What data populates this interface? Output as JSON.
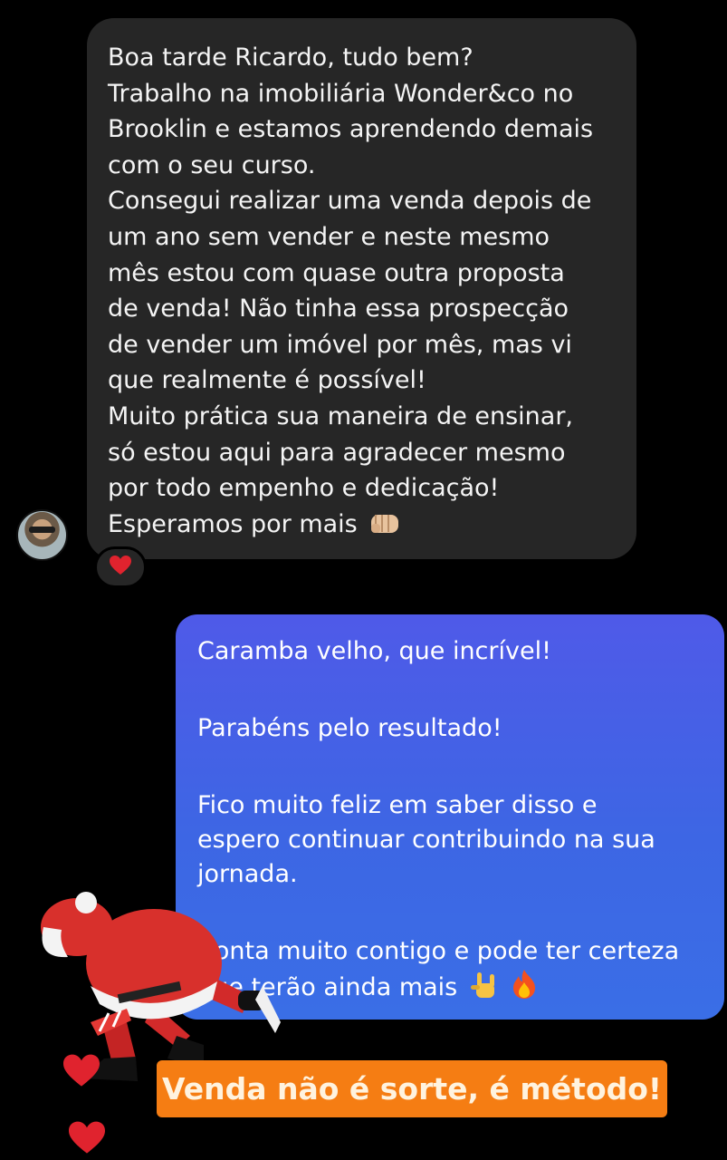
{
  "incoming_message": {
    "lines": [
      "Boa tarde Ricardo, tudo bem?",
      "Trabalho na imobiliária Wonder&co no",
      "Brooklin e estamos aprendendo demais",
      "com o seu curso.",
      "Consegui realizar uma venda depois de",
      "um ano sem vender e neste mesmo",
      "mês estou com quase outra proposta",
      "de venda! Não tinha essa prospecção",
      "de vender um imóvel por mês, mas vi",
      "que realmente é possível!",
      "Muito prática sua maneira de ensinar,",
      "só estou aqui para agradecer mesmo",
      "por todo empenho e dedicação!",
      "Esperamos por mais"
    ],
    "end_emoji": "fist-bump-icon",
    "reaction": "red-heart-icon"
  },
  "outgoing_message": {
    "lines": [
      "Caramba velho, que incrível!",
      "",
      "Parabéns pelo resultado!",
      "",
      "Fico muito feliz em saber disso e",
      "espero continuar contribuindo na sua",
      "jornada.",
      "",
      "Conta muito contigo e pode ter certeza",
      "que terão ainda mais"
    ],
    "end_emojis": [
      "rock-hand-icon",
      "fire-icon"
    ]
  },
  "banner": {
    "text": "Venda não é sorte, é método!"
  },
  "colors": {
    "background": "#000000",
    "incoming_bubble": "#262626",
    "outgoing_bubble_top": "#4f5ae8",
    "outgoing_bubble_bottom": "#3a6ee6",
    "banner": "#f57d13",
    "heart": "#e0232e"
  }
}
